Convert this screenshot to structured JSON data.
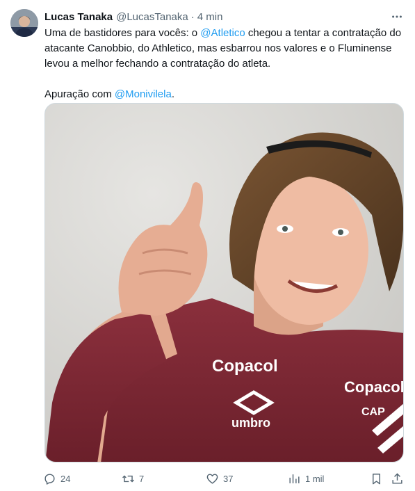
{
  "author": {
    "display_name": "Lucas Tanaka",
    "handle": "@LucasTanaka",
    "separator": "·",
    "time": "4 min"
  },
  "tweet": {
    "segments_line1": [
      {
        "text": "Uma de bastidores para vocês: o ",
        "type": "text"
      },
      {
        "text": "@Atletico",
        "type": "mention"
      },
      {
        "text": " chegou a tentar a contratação do atacante Canobbio, do Athletico, mas esbarrou nos valores e o Fluminense levou a melhor fechando a contratação do atleta.",
        "type": "text"
      }
    ],
    "p1_a": "Uma de bastidores para vocês: o ",
    "p1_mention": "@Atletico",
    "p1_b": " chegou a tentar a contratação do atacante Canobbio, do Athletico, mas esbarrou nos valores e o Fluminense levou a melhor fechando a contratação do atleta.",
    "p2_a": "Apuração com ",
    "p2_mention": "@Monivilela",
    "p2_b": "."
  },
  "media": {
    "shirt_sponsor": "Copacol",
    "shirt_brand": "umbro",
    "shirt_sponsor_2": "Copacol",
    "shirt_badge": "CAP",
    "colors": {
      "shirt": "#7a2734",
      "skin": "#e9b59c",
      "hair": "#6b4a2b",
      "background": "#d6d5d2"
    }
  },
  "actions": {
    "reply": {
      "icon": "reply-icon",
      "count": "24"
    },
    "retweet": {
      "icon": "retweet-icon",
      "count": "7"
    },
    "like": {
      "icon": "heart-icon",
      "count": "37"
    },
    "views": {
      "icon": "views-icon",
      "count": "1 mil"
    },
    "bookmark": {
      "icon": "bookmark-icon"
    },
    "share": {
      "icon": "share-icon"
    }
  },
  "colors": {
    "accent": "#1d9bf0",
    "muted": "#536471",
    "text": "#0f1419"
  }
}
